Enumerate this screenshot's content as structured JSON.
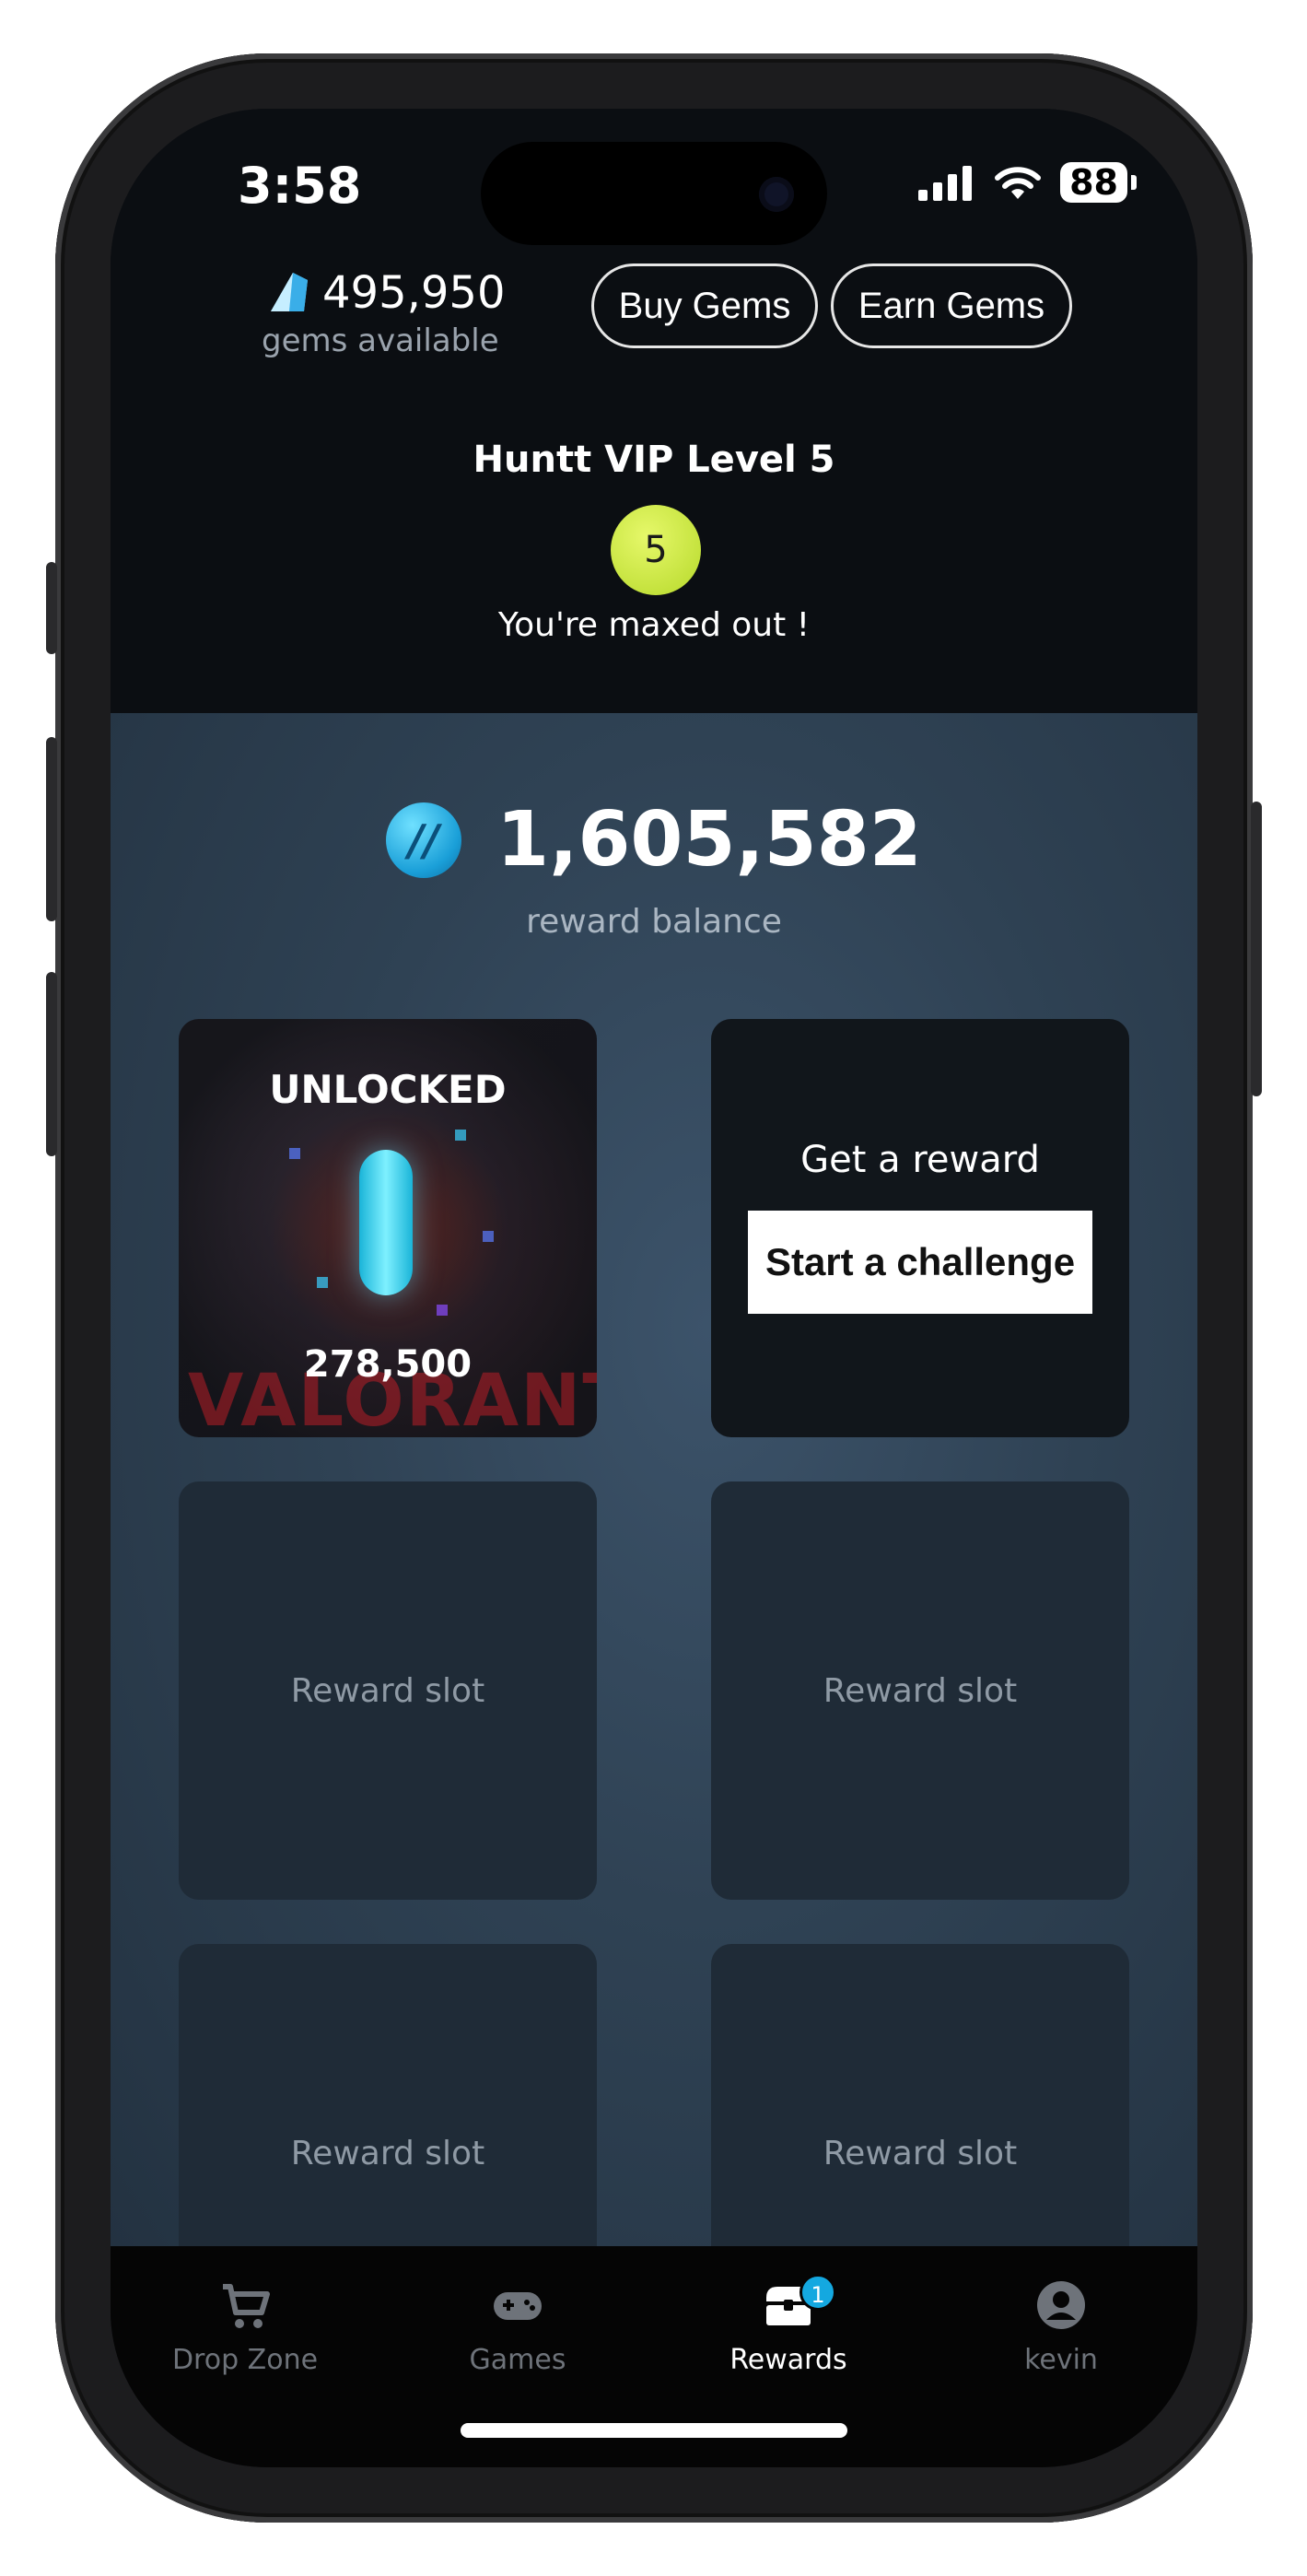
{
  "status_bar": {
    "time": "3:58",
    "battery": "88"
  },
  "header": {
    "gems_count": "495,950",
    "gems_label": "gems available",
    "buy_gems": "Buy Gems",
    "earn_gems": "Earn Gems",
    "vip_title": "Huntt VIP Level 5",
    "vip_level": "5",
    "vip_subtitle": "You're maxed out !"
  },
  "rewards": {
    "balance": "1,605,582",
    "balance_label": "reward balance",
    "unlocked_card": {
      "title": "UNLOCKED",
      "value": "278,500",
      "brand": "VALORANT"
    },
    "challenge_card": {
      "title": "Get a reward",
      "button": "Start a challenge"
    },
    "slots": [
      "Reward slot",
      "Reward slot",
      "Reward slot",
      "Reward slot"
    ]
  },
  "tabbar": {
    "items": [
      {
        "label": "Drop Zone",
        "icon": "cart-icon"
      },
      {
        "label": "Games",
        "icon": "gamepad-icon"
      },
      {
        "label": "Rewards",
        "icon": "treasure-chest-icon",
        "badge": "1",
        "active": true
      },
      {
        "label": "kevin",
        "icon": "account-icon"
      }
    ]
  },
  "colors": {
    "accent_badge": "#14a8e0",
    "vip_badge": "#c8e83a",
    "coin": "#1a9fd8"
  }
}
